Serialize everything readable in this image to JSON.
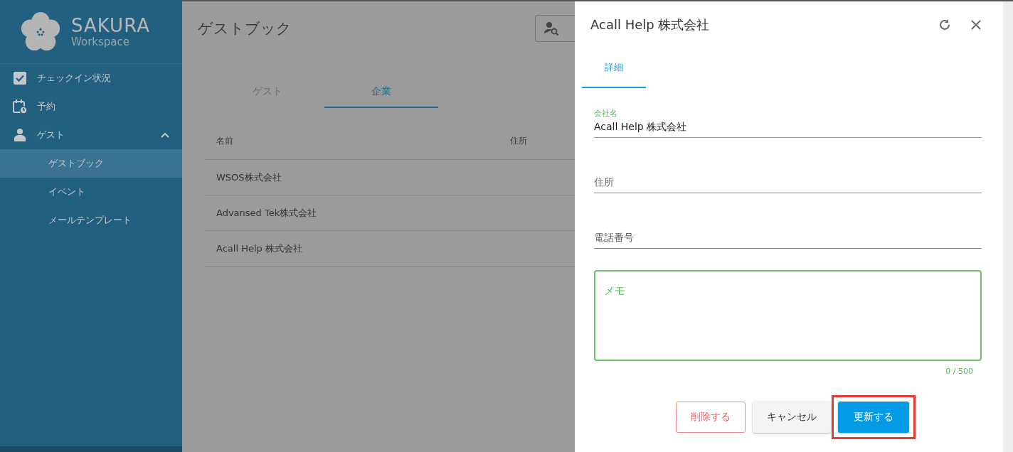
{
  "sidebar": {
    "logo": {
      "title": "SAKURA",
      "subtitle": "Workspace"
    },
    "items": [
      {
        "kind": "check",
        "label": "チェックイン状況",
        "selected": false
      },
      {
        "kind": "calendar",
        "label": "予約",
        "selected": false
      },
      {
        "kind": "person",
        "label": "ゲスト",
        "selected": false,
        "expanded": true,
        "children": [
          {
            "label": "ゲストブック",
            "selected": true
          },
          {
            "label": "イベント",
            "selected": false
          },
          {
            "label": "メールテンプレート",
            "selected": false
          }
        ]
      }
    ]
  },
  "page": {
    "title": "ゲストブック",
    "tabs": [
      {
        "label": "ゲスト",
        "selected": false
      },
      {
        "label": "企業",
        "selected": true
      }
    ],
    "table": {
      "columns": [
        "名前",
        "住所"
      ],
      "rows": [
        {
          "name": "WSOS株式会社"
        },
        {
          "name": "Advansed Tek株式会社"
        },
        {
          "name": "Acall Help 株式会社"
        }
      ]
    }
  },
  "dialog": {
    "title": "Acall Help 株式会社",
    "tabs": [
      {
        "label": "詳細",
        "selected": true
      }
    ],
    "fields": [
      {
        "label": "会社名",
        "value": "Acall Help 株式会社"
      },
      {
        "label": "住所"
      },
      {
        "label": "電話番号"
      }
    ],
    "memo": {
      "label": "メモ",
      "counter": "0 / 500",
      "focused": true
    },
    "buttons": [
      {
        "kind": "danger",
        "label": "削除する",
        "highlighted": false
      },
      {
        "kind": "plain",
        "label": "キャンセル",
        "highlighted": false
      },
      {
        "kind": "primary",
        "label": "更新する",
        "highlighted": true
      }
    ]
  }
}
